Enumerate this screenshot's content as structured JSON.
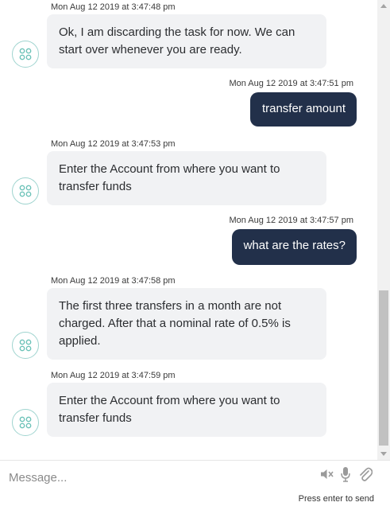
{
  "conversation": {
    "messages": [
      {
        "sender": "bot",
        "timestamp": "Mon Aug 12 2019 at 3:47:48 pm",
        "text": "Ok, I am discarding the task for now. We can start over whenever you are ready."
      },
      {
        "sender": "user",
        "timestamp": "Mon Aug 12 2019 at 3:47:51 pm",
        "text": "transfer amount"
      },
      {
        "sender": "bot",
        "timestamp": "Mon Aug 12 2019 at 3:47:53 pm",
        "text": "Enter the Account from where you want to transfer funds"
      },
      {
        "sender": "user",
        "timestamp": "Mon Aug 12 2019 at 3:47:57 pm",
        "text": "what are the rates?"
      },
      {
        "sender": "bot",
        "timestamp": "Mon Aug 12 2019 at 3:47:58 pm",
        "text": "The first three transfers in a month are not charged. After that a nominal rate of 0.5% is applied."
      },
      {
        "sender": "bot",
        "timestamp": "Mon Aug 12 2019 at 3:47:59 pm",
        "text": "Enter the Account from where you want to transfer funds"
      }
    ]
  },
  "composer": {
    "placeholder": "Message...",
    "hint": "Press enter to send",
    "icons": [
      "speaker-mute-icon",
      "microphone-icon",
      "paperclip-icon"
    ]
  },
  "colors": {
    "bot_bubble": "#f1f2f4",
    "user_bubble": "#22304a",
    "avatar_accent": "#9fd4cf"
  }
}
